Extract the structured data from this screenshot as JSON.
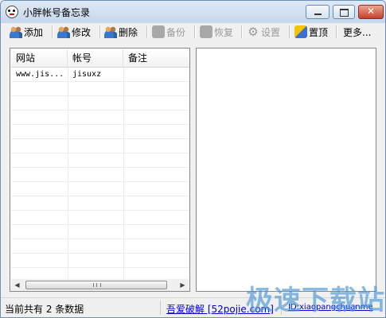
{
  "window": {
    "title": "小胖帐号备忘录"
  },
  "toolbar": {
    "add": "添加",
    "edit": "修改",
    "delete": "删除",
    "backup": "备份",
    "restore": "恢复",
    "settings": "设置",
    "pin": "置顶",
    "more": "更多..."
  },
  "table": {
    "columns": [
      "网站",
      "帐号",
      "备注"
    ],
    "rows": [
      {
        "site": "www.jis...",
        "account": "jisuxz",
        "note": ""
      }
    ]
  },
  "scrollbar": {
    "grip": "III"
  },
  "status": {
    "count_text": "当前共有 2 条数据",
    "link1": "吾爱破解 [52pojie.com]",
    "link2": "ID:xiaopangchuanme"
  },
  "watermark": "极速下载站"
}
